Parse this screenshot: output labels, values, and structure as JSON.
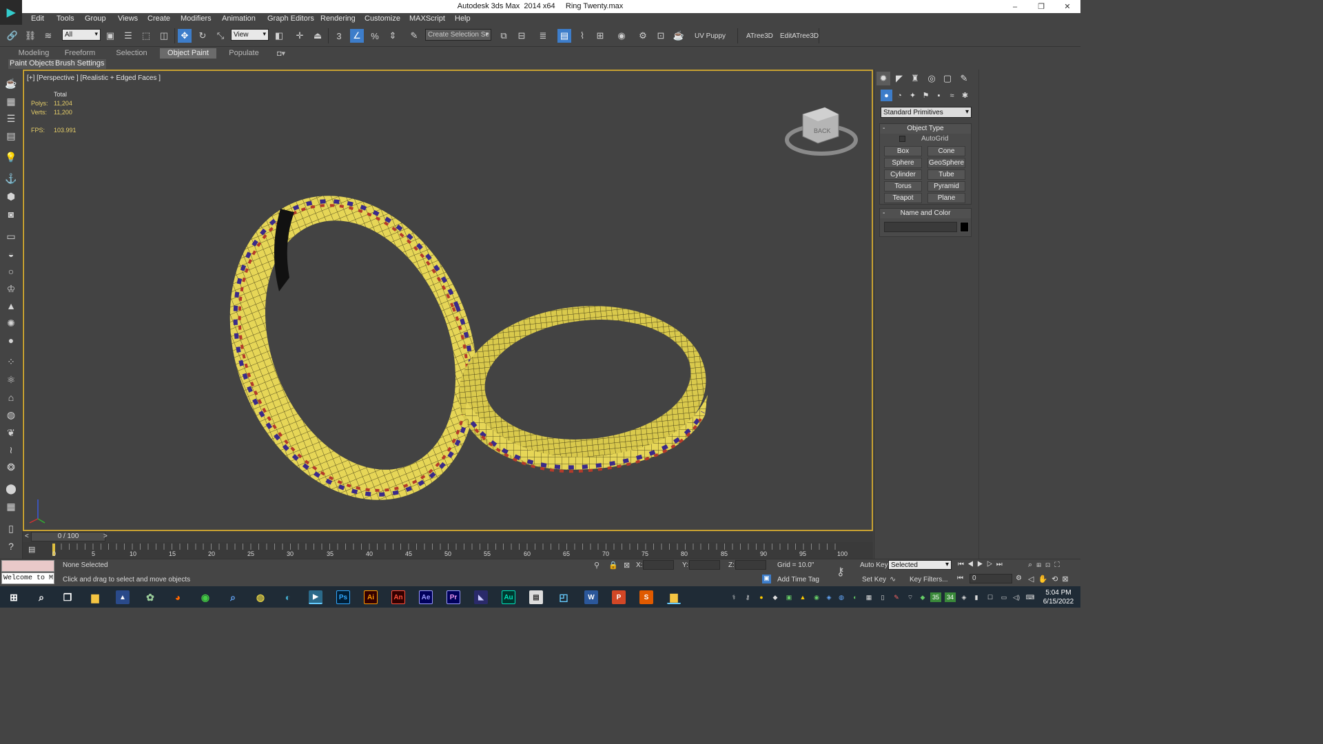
{
  "window": {
    "title": "Autodesk 3ds Max  2014 x64     Ring Twenty.max",
    "minimize_label": "–",
    "restore_label": "❐",
    "close_label": "✕",
    "logo": "▶"
  },
  "menu": [
    "Edit",
    "Tools",
    "Group",
    "Views",
    "Create",
    "Modifiers",
    "Animation",
    "Graph Editors",
    "Rendering",
    "Customize",
    "MAXScript",
    "Help"
  ],
  "toolbar": {
    "selection_filter": "All",
    "coord_system": "View",
    "named_selection": "Create Selection Se",
    "uv_puppy": "UV Puppy",
    "atree": "ATree3D",
    "edit_atree": "EditATree3D",
    "snap_label": "3",
    "percent_label": "%"
  },
  "ribbon": {
    "tabs": [
      "Modeling",
      "Freeform",
      "Selection",
      "Object Paint",
      "Populate"
    ],
    "active_tab": "Object Paint"
  },
  "subribbon": {
    "paint_objects": "Paint Objects",
    "brush_settings": "Brush Settings"
  },
  "viewport": {
    "label": "[+] [Perspective ] [Realistic + Edged Faces ]",
    "stats": {
      "total_label": "Total",
      "polys_label": "Polys:",
      "polys_value": "11,204",
      "verts_label": "Verts:",
      "verts_value": "11,200",
      "fps_label": "FPS:",
      "fps_value": "103.991"
    },
    "viewcube_face": "BACK",
    "colors": {
      "gold": "#ebdb5a",
      "gem_red": "#c0322a",
      "gem_blue": "#5a4ec8",
      "frame": "#c8a232"
    }
  },
  "command_panel": {
    "dropdown": "Standard Primitives",
    "object_type": {
      "header": "Object Type",
      "autogrid": "AutoGrid",
      "buttons": [
        "Box",
        "Cone",
        "Sphere",
        "GeoSphere",
        "Cylinder",
        "Tube",
        "Torus",
        "Pyramid",
        "Teapot",
        "Plane"
      ]
    },
    "name_and_color": {
      "header": "Name and Color",
      "collapse": "-",
      "name_value": ""
    }
  },
  "timeline": {
    "frame_display": "0 / 100",
    "prev": "<",
    "next": ">",
    "ticks": [
      "0",
      "5",
      "10",
      "15",
      "20",
      "25",
      "30",
      "35",
      "40",
      "45",
      "50",
      "55",
      "60",
      "65",
      "70",
      "75",
      "80",
      "85",
      "90",
      "95",
      "100"
    ]
  },
  "status": {
    "selection": "None Selected",
    "prompt": "Click and drag to select and move objects",
    "maxscript_listener": "Welcome to M",
    "x_label": "X:",
    "y_label": "Y:",
    "z_label": "Z:",
    "grid": "Grid = 10.0\"",
    "add_time_tag": "Add Time Tag",
    "auto_key": "Auto Key",
    "set_key": "Set Key",
    "key_mode": "Selected",
    "key_filters": "Key Filters...",
    "frame_value": "0"
  },
  "taskbar": {
    "apps": [
      {
        "name": "Ps",
        "color": "#31a8ff"
      },
      {
        "name": "Ai",
        "color": "#ff9a00"
      },
      {
        "name": "An",
        "color": "#ff4f3b"
      },
      {
        "name": "Ae",
        "color": "#9999ff"
      },
      {
        "name": "Pr",
        "color": "#9999ff"
      },
      {
        "name": "Au",
        "color": "#00e4bb"
      }
    ],
    "tray_numbers": [
      "35",
      "34"
    ],
    "time": "5:04 PM",
    "date": "6/15/2022"
  }
}
